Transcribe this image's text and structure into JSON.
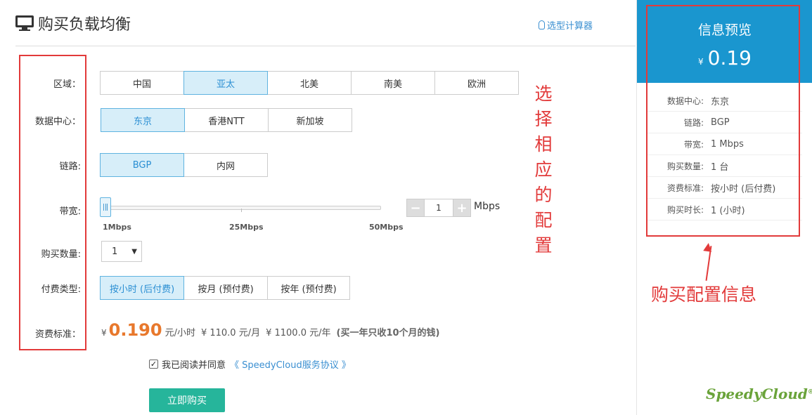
{
  "header": {
    "title": "购买负载均衡",
    "calculator_link": "选型计算器"
  },
  "form": {
    "region": {
      "label": "区域：",
      "options": [
        "中国",
        "亚太",
        "北美",
        "南美",
        "欧洲"
      ],
      "selected": "亚太"
    },
    "datacenter": {
      "label": "数据中心：",
      "options": [
        "东京",
        "香港NTT",
        "新加坡"
      ],
      "selected": "东京"
    },
    "link": {
      "label": "链路:",
      "options": [
        "BGP",
        "内网"
      ],
      "selected": "BGP"
    },
    "bandwidth": {
      "label": "带宽:",
      "tick_labels": [
        "1Mbps",
        "25Mbps",
        "50Mbps"
      ],
      "min": 1,
      "max": 50,
      "value": 1,
      "stepper_minus": "−",
      "stepper_plus": "+",
      "unit": "Mbps"
    },
    "quantity": {
      "label": "购买数量:",
      "value": "1",
      "caret": "▼"
    },
    "payment": {
      "label": "付费类型:",
      "options": [
        "按小时 (后付费)",
        "按月 (预付费)",
        "按年 (预付费)"
      ],
      "selected": "按小时 (后付费)"
    },
    "pricing": {
      "label": "资费标准：",
      "currency": "¥",
      "hourly_price": "0.190",
      "hourly_unit": "元/小时",
      "monthly": "¥ 110.0 元/月",
      "yearly": "¥ 1100.0 元/年",
      "note": "(买一年只收10个月的钱)"
    },
    "agreement": {
      "checked": true,
      "check_mark": "✓",
      "text": "我已阅读并同意",
      "link": "《 SpeedyCloud服务协议 》"
    },
    "buy_button": "立即购买"
  },
  "sidebar": {
    "title": "信息预览",
    "currency": "¥",
    "price": "0.19",
    "rows": [
      {
        "key": "数据中心:",
        "value": "东京"
      },
      {
        "key": "链路:",
        "value": "BGP"
      },
      {
        "key": "带宽:",
        "value": "1 Mbps"
      },
      {
        "key": "购买数量:",
        "value": "1 台"
      },
      {
        "key": "资费标准:",
        "value": "按小时 (后付费)"
      },
      {
        "key": "购买时长:",
        "value": "1 (小时)"
      }
    ],
    "brand": "SpeedyCloud",
    "brand_mark": "®"
  },
  "annotations": {
    "vertical_text": "选择相应的配置",
    "right_text": "购买配置信息",
    "color": "#e23a3a"
  },
  "colors": {
    "accent": "#1a96cf",
    "buy": "#26b59b",
    "price": "#e8782c",
    "selected_bg": "#d7eef9"
  }
}
